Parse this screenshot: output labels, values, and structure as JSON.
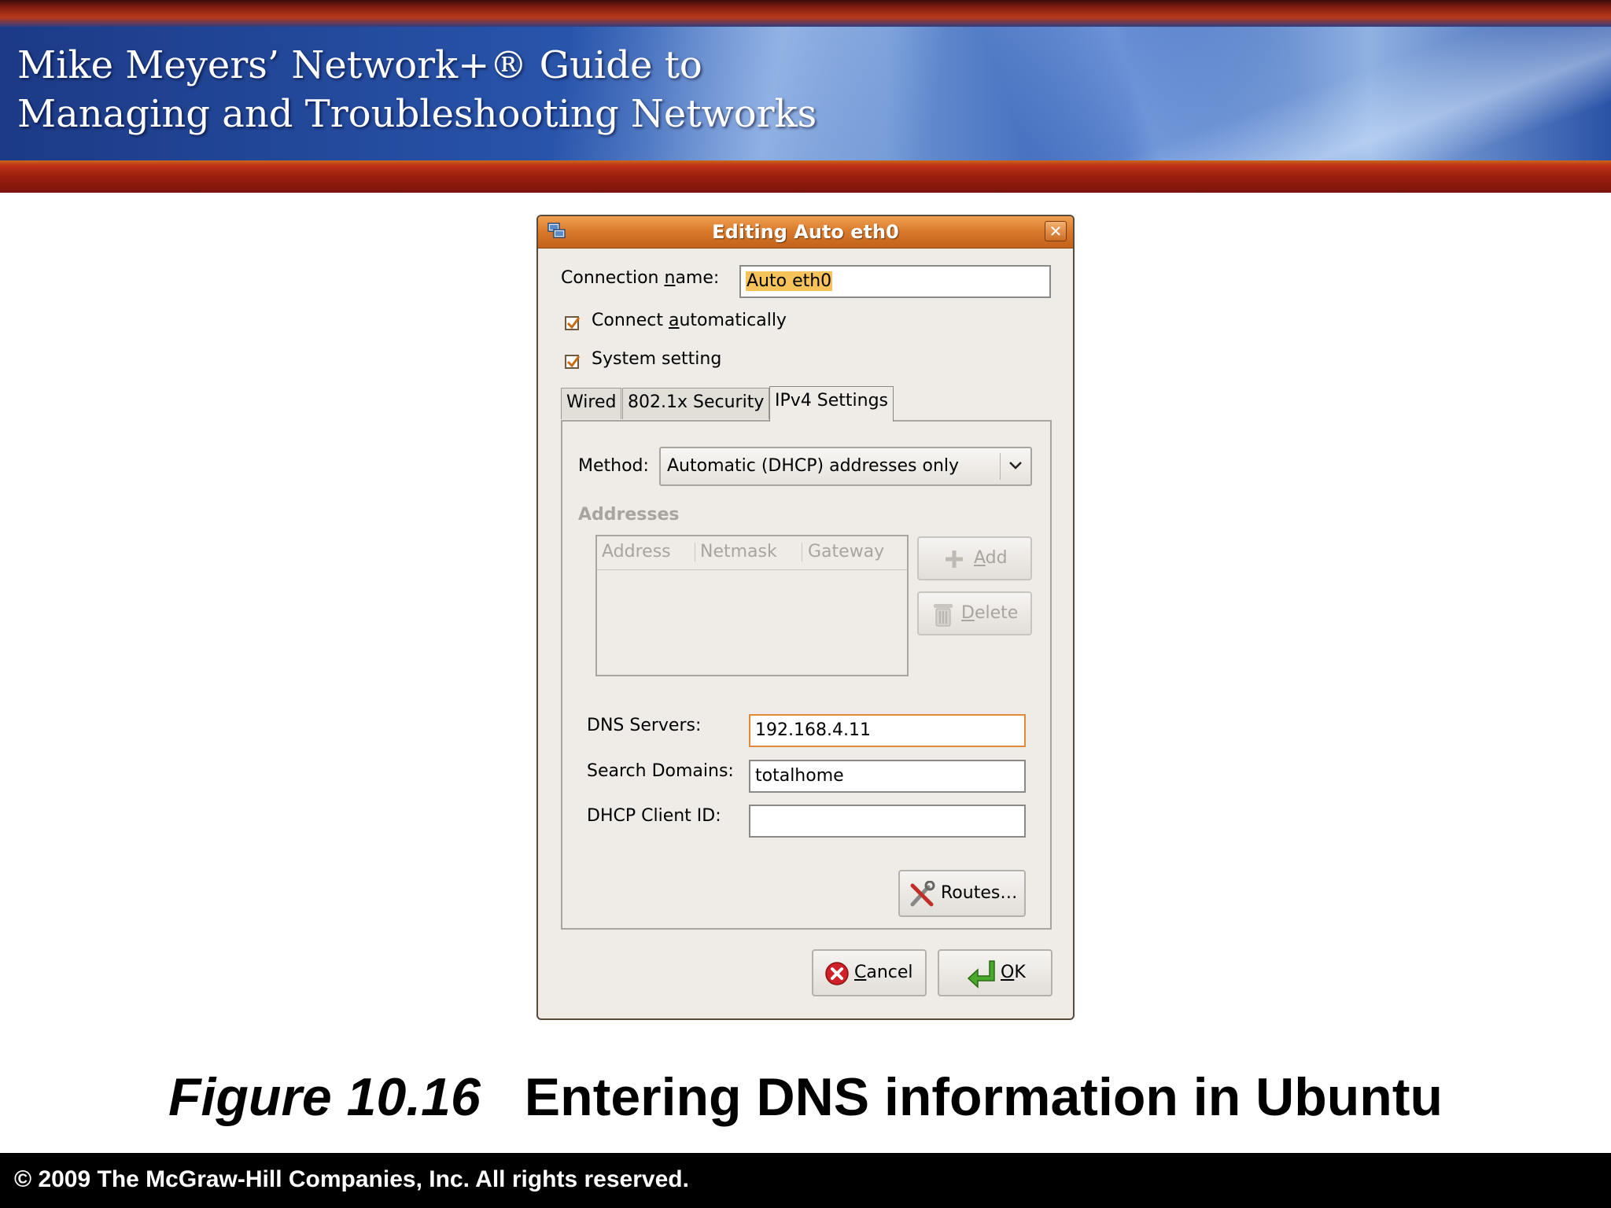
{
  "slide": {
    "title_line1": "Mike Meyers’ Network+® Guide to",
    "title_line2": "Managing and Troubleshooting Networks",
    "caption_figure": "Figure 10.16",
    "caption_text": "Entering DNS information in Ubuntu",
    "footer": "© 2009 The McGraw-Hill Companies, Inc. All rights reserved."
  },
  "dialog": {
    "title": "Editing Auto eth0",
    "close_glyph": "✕",
    "connection_name_label_pre": "Connection ",
    "connection_name_label_u": "n",
    "connection_name_label_post": "ame:",
    "connection_name_value": "Auto eth0",
    "connect_auto_pre": "Connect ",
    "connect_auto_u": "a",
    "connect_auto_post": "utomatically",
    "system_setting": "System setting",
    "tabs": [
      "Wired",
      "802.1x Security",
      "IPv4 Settings"
    ],
    "method_label": "Method:",
    "method_value": "Automatic (DHCP) addresses only",
    "addresses_heading": "Addresses",
    "columns": [
      "Address",
      "Netmask",
      "Gateway"
    ],
    "add_u": "A",
    "add_rest": "dd",
    "delete_u": "D",
    "delete_rest": "elete",
    "dns_label": "DNS Servers:",
    "dns_value": "192.168.4.11",
    "search_label": "Search Domains:",
    "search_value": "totalhome",
    "dhcp_label": "DHCP Client ID:",
    "dhcp_value": "",
    "routes": "Routes…",
    "cancel_u": "C",
    "cancel_rest": "ancel",
    "ok_u": "O",
    "ok_rest": "K"
  },
  "colors": {
    "titlebar": "#d8782a",
    "focus": "#e08a3c",
    "selection": "#f6c35a",
    "cancel_icon": "#d0202a",
    "ok_icon": "#4aa82a"
  }
}
